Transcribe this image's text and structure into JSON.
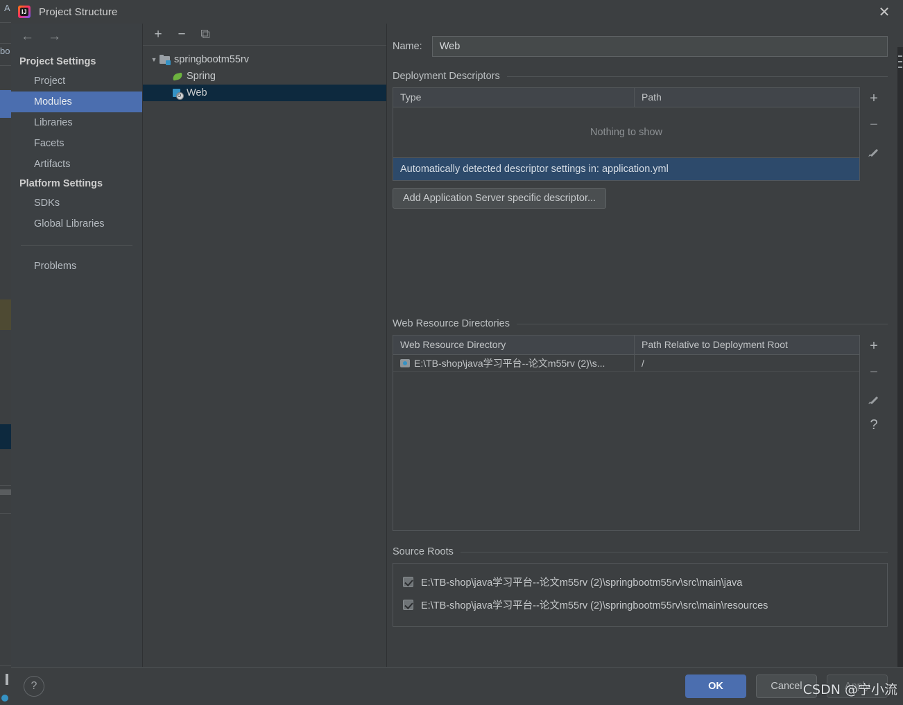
{
  "window": {
    "title": "Project Structure",
    "app_icon": "intellij-idea-icon",
    "close_icon": "close-icon"
  },
  "nav": {
    "back_icon": "arrow-left-icon",
    "forward_icon": "arrow-right-icon"
  },
  "sidebar": {
    "groups": [
      {
        "label": "Project Settings",
        "items": [
          {
            "label": "Project",
            "selected": false
          },
          {
            "label": "Modules",
            "selected": true
          },
          {
            "label": "Libraries",
            "selected": false
          },
          {
            "label": "Facets",
            "selected": false
          },
          {
            "label": "Artifacts",
            "selected": false
          }
        ]
      },
      {
        "label": "Platform Settings",
        "items": [
          {
            "label": "SDKs",
            "selected": false
          },
          {
            "label": "Global Libraries",
            "selected": false
          }
        ]
      }
    ],
    "extra_item": {
      "label": "Problems",
      "selected": false
    }
  },
  "tree": {
    "toolbar": {
      "add_icon": "plus-icon",
      "remove_icon": "minus-icon",
      "copy_icon": "copy-icon"
    },
    "nodes": [
      {
        "label": "springbootm55rv",
        "icon": "module-icon",
        "expanded": true,
        "depth": 0,
        "selected": false,
        "twisty": "▼"
      },
      {
        "label": "Spring",
        "icon": "spring-leaf-icon",
        "depth": 1,
        "selected": false,
        "twisty": ""
      },
      {
        "label": "Web",
        "icon": "web-facet-icon",
        "depth": 1,
        "selected": true,
        "twisty": ""
      }
    ]
  },
  "main": {
    "name_field": {
      "label": "Name:",
      "value": "Web",
      "placeholder": ""
    },
    "deployment_descriptors": {
      "title": "Deployment Descriptors",
      "columns": [
        "Type",
        "Path"
      ],
      "rows": [],
      "empty_text": "Nothing to show",
      "notice": "Automatically detected descriptor settings in: application.yml",
      "add_button": "Add Application Server specific descriptor...",
      "tools": [
        {
          "name": "add-descriptor-icon",
          "glyph": "+"
        },
        {
          "name": "remove-descriptor-icon",
          "glyph": "–"
        },
        {
          "name": "edit-descriptor-icon",
          "glyph": "pencil"
        }
      ]
    },
    "web_resource_directories": {
      "title": "Web Resource Directories",
      "columns": [
        "Web Resource Directory",
        "Path Relative to Deployment Root"
      ],
      "rows": [
        {
          "directory": "E:\\TB-shop\\java学习平台--论文m55rv (2)\\s...",
          "relative_path": "/",
          "icon": "web-resource-dir-icon"
        }
      ],
      "tools": [
        {
          "name": "add-web-resource-icon",
          "glyph": "+"
        },
        {
          "name": "remove-web-resource-icon",
          "glyph": "–"
        },
        {
          "name": "edit-web-resource-icon",
          "glyph": "pencil"
        },
        {
          "name": "help-web-resource-icon",
          "glyph": "?"
        }
      ]
    },
    "source_roots": {
      "title": "Source Roots",
      "items": [
        {
          "path": "E:\\TB-shop\\java学习平台--论文m55rv (2)\\springbootm55rv\\src\\main\\java",
          "checked": true
        },
        {
          "path": "E:\\TB-shop\\java学习平台--论文m55rv (2)\\springbootm55rv\\src\\main\\resources",
          "checked": true
        }
      ]
    }
  },
  "footer": {
    "help_icon": "help-icon",
    "help_glyph": "?",
    "ok": "OK",
    "cancel": "Cancel",
    "apply": "Apply"
  },
  "watermark": "CSDN @宁小流",
  "background_editor": {
    "line_a": "A",
    "line_b": "bo"
  },
  "colors": {
    "dialog_bg": "#3c3f41",
    "sidebar_bg": "#3c4043",
    "selection_blue": "#4b6eaf",
    "tree_selection": "#0d293e",
    "notice_blue": "#2d4a6b",
    "text": "#bbbbbb",
    "accent_spring": "#6db33f",
    "accent_web": "#3592c4"
  }
}
